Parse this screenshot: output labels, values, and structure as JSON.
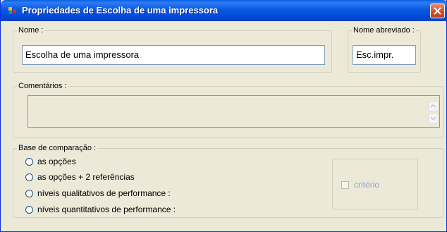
{
  "window": {
    "title": "Propriedades de  Escolha de uma impressora",
    "close_icon": "close-icon"
  },
  "name_group": {
    "legend": "Nome :",
    "value": "Escolha de uma impressora"
  },
  "short_name_group": {
    "legend": "Nome abreviado :",
    "value": "Esc.impr."
  },
  "comments_group": {
    "legend": "Comentários :",
    "value": ""
  },
  "comparison_group": {
    "legend": "Base de comparação :",
    "options": [
      {
        "label": "as opções"
      },
      {
        "label": "as opções + 2 referências"
      },
      {
        "label": "níveis qualitativos de performance :"
      },
      {
        "label": "níveis quantitativos de performance :"
      }
    ],
    "criterion_label": "critério"
  },
  "colors": {
    "title_bar": "#0a58e0",
    "dialog_bg": "#ece9d8",
    "field_border": "#7f9db9",
    "disabled_text": "#8da6d8"
  }
}
